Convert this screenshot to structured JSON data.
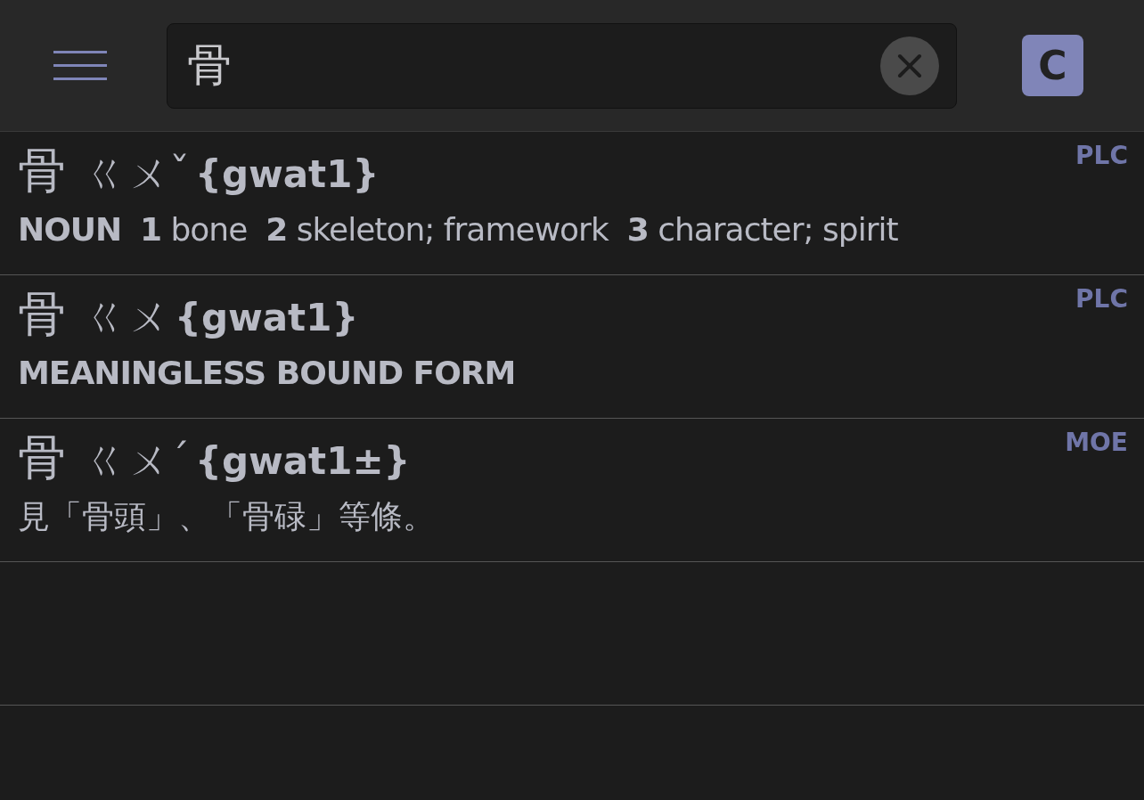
{
  "search": {
    "value": "骨"
  },
  "mode_button": "C",
  "entries": [
    {
      "headword": "骨",
      "zhuyin": "ㄍㄨˇ",
      "jyutping": "{gwat1}",
      "source": "PLC",
      "kind": "english",
      "definition": "**NOUN**  **1** bone  **2** skeleton; framework  **3** character; spirit"
    },
    {
      "headword": "骨",
      "zhuyin": "ㄍㄨ",
      "jyutping": "{gwat1}",
      "source": "PLC",
      "kind": "label",
      "definition": "MEANINGLESS BOUND FORM"
    },
    {
      "headword": "骨",
      "zhuyin": "ㄍㄨˊ",
      "jyutping": "{gwat1±}",
      "source": "MOE",
      "kind": "chinese",
      "definition": "見「骨頭」、「骨碌」等條。"
    }
  ]
}
